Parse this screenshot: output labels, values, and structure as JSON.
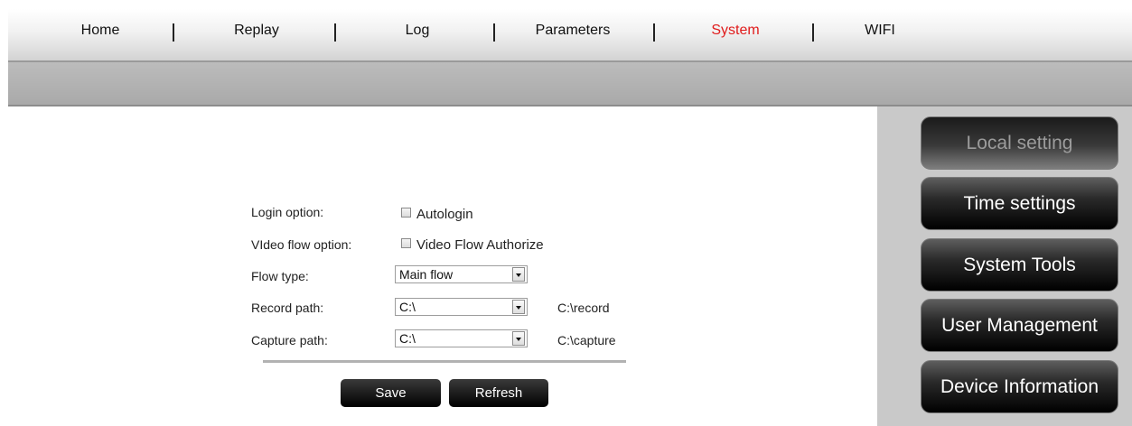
{
  "nav": {
    "items": [
      "Home",
      "Replay",
      "Log",
      "Parameters",
      "System",
      "WIFI"
    ],
    "active": "System",
    "active_color": "#e01c1c"
  },
  "form": {
    "login_option_label": "Login option:",
    "autologin_label": "Autologin",
    "video_flow_label": "VIdeo flow option:",
    "video_flow_authorize_label": "Video Flow Authorize",
    "flow_type_label": "Flow type:",
    "flow_type_value": "Main flow",
    "record_path_label": "Record path:",
    "record_path_value": "C:\\",
    "record_path_full": "C:\\record",
    "capture_path_label": "Capture path:",
    "capture_path_value": "C:\\",
    "capture_path_full": "C:\\capture",
    "save_label": "Save",
    "refresh_label": "Refresh"
  },
  "sidebar": {
    "items": [
      "Local setting",
      "Time settings",
      "System Tools",
      "User Management",
      "Device Information"
    ],
    "active": "Local setting"
  }
}
